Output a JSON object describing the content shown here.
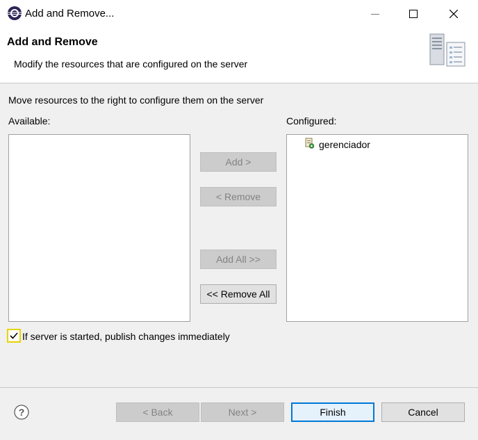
{
  "window": {
    "title": "Add and Remove...",
    "controls": {
      "minimize": "minimize-icon",
      "maximize": "maximize-icon",
      "close": "close-icon"
    }
  },
  "header": {
    "title": "Add and Remove",
    "description": "Modify the resources that are configured on the server",
    "graphic": "server-icon"
  },
  "main": {
    "instruction": "Move resources to the right to configure them on the server",
    "available_label": "Available:",
    "configured_label": "Configured:",
    "available_items": [],
    "configured_items": [
      {
        "label": "gerenciador",
        "icon": "web-module-icon"
      }
    ],
    "buttons": {
      "add": "Add >",
      "remove": "< Remove",
      "add_all": "Add All >>",
      "remove_all": "<< Remove All"
    },
    "publish_checkbox": {
      "label": "If server is started, publish changes immediately",
      "checked": true
    }
  },
  "footer": {
    "help_icon": "help-icon",
    "back": "< Back",
    "next": "Next >",
    "finish": "Finish",
    "cancel": "Cancel"
  },
  "colors": {
    "accent": "#0078d7",
    "focus_highlight": "#e8d300",
    "disabled_text": "#838383"
  }
}
